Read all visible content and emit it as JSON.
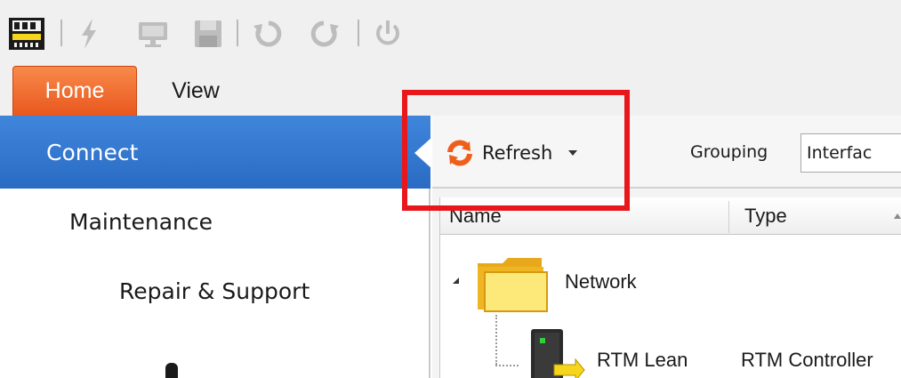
{
  "quick_access": {
    "items": [
      {
        "icon": "app-logo-icon"
      },
      {
        "icon": "lightning-icon"
      },
      {
        "icon": "monitor-icon"
      },
      {
        "icon": "save-icon"
      },
      {
        "icon": "undo-icon"
      },
      {
        "icon": "redo-icon"
      },
      {
        "icon": "power-icon"
      }
    ]
  },
  "ribbon": {
    "tabs": [
      {
        "label": "Home",
        "active": true
      },
      {
        "label": "View",
        "active": false
      }
    ],
    "active_tab_color": "#ef6a2e"
  },
  "nav": {
    "selected_color": "#2f74cf",
    "items": [
      {
        "label": "Connect",
        "selected": true
      },
      {
        "label": "Maintenance",
        "selected": false
      },
      {
        "label": "Repair & Support",
        "selected": false
      }
    ]
  },
  "toolbar": {
    "refresh_label": "Refresh",
    "refresh_icon": "refresh-icon",
    "grouping_label": "Grouping",
    "grouping_value": "Interfac"
  },
  "grid": {
    "columns": [
      {
        "label": "Name"
      },
      {
        "label": "Type"
      }
    ],
    "rows": [
      {
        "name": "Network",
        "type": "",
        "icon": "folder-icon",
        "expanded": true
      },
      {
        "name": "RTM Lean",
        "type": "RTM Controller",
        "icon": "device-icon"
      }
    ]
  },
  "highlight_color": "#e8171c"
}
